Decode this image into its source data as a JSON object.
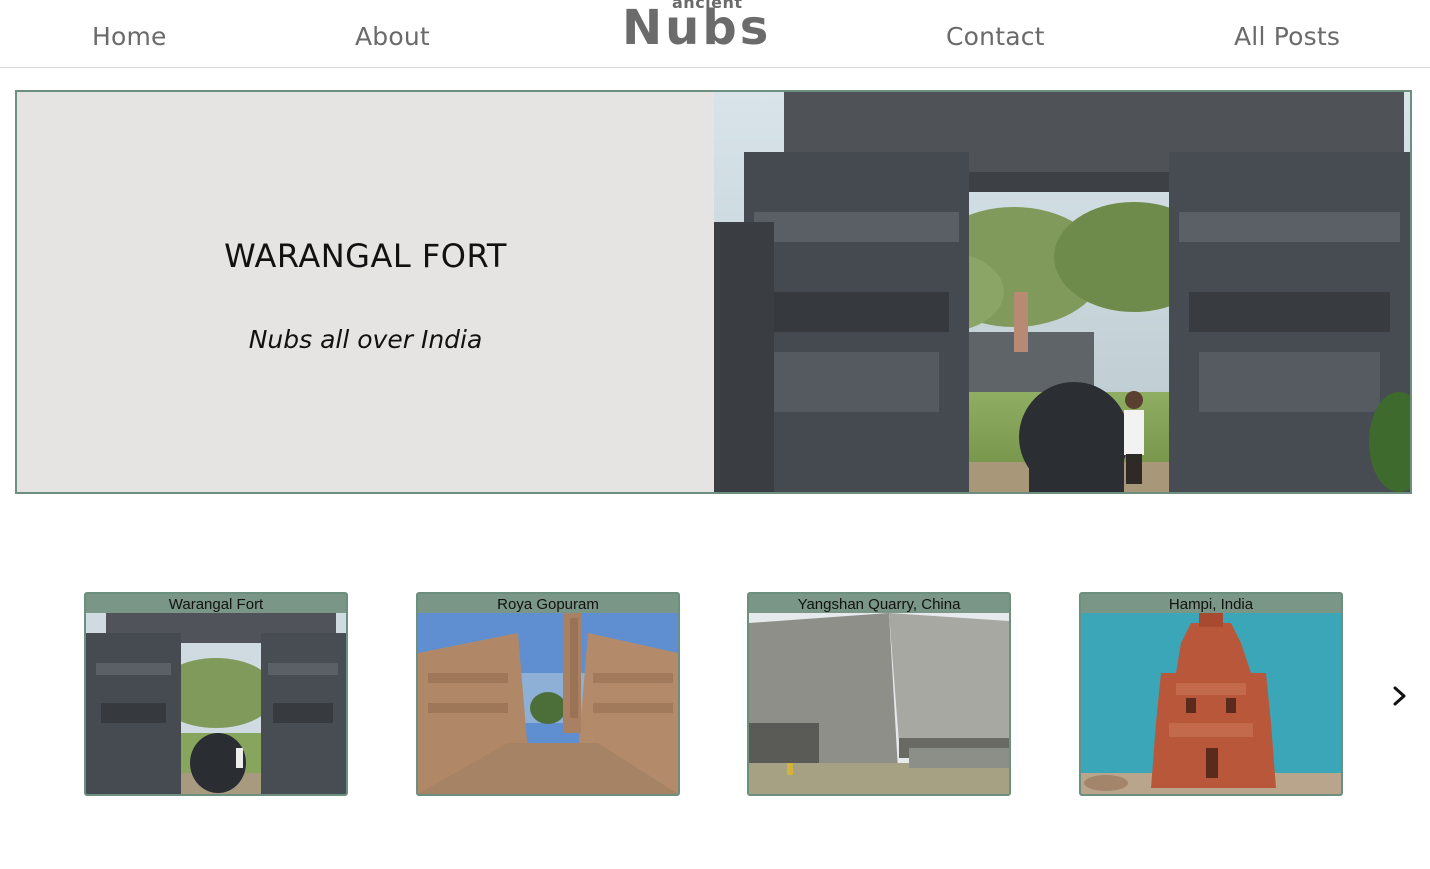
{
  "nav": {
    "links": [
      {
        "label": "Home"
      },
      {
        "label": "About"
      },
      {
        "label": "Contact"
      },
      {
        "label": "All Posts"
      }
    ],
    "logo": {
      "sub": "ancient",
      "main": "Nubs"
    }
  },
  "hero": {
    "title": "WARANGAL FORT",
    "subtitle": "Nubs all over India"
  },
  "cards": [
    {
      "title": "Warangal Fort"
    },
    {
      "title": "Roya Gopuram"
    },
    {
      "title": "Yangshan Quarry, China"
    },
    {
      "title": "Hampi, India"
    }
  ],
  "carousel": {
    "next_icon": "chevron-right-icon"
  },
  "colors": {
    "accent": "#7a9686",
    "border": "#6d8f7f",
    "hero_bg": "#e6e3e3",
    "nav_text": "#6a6a6a"
  }
}
